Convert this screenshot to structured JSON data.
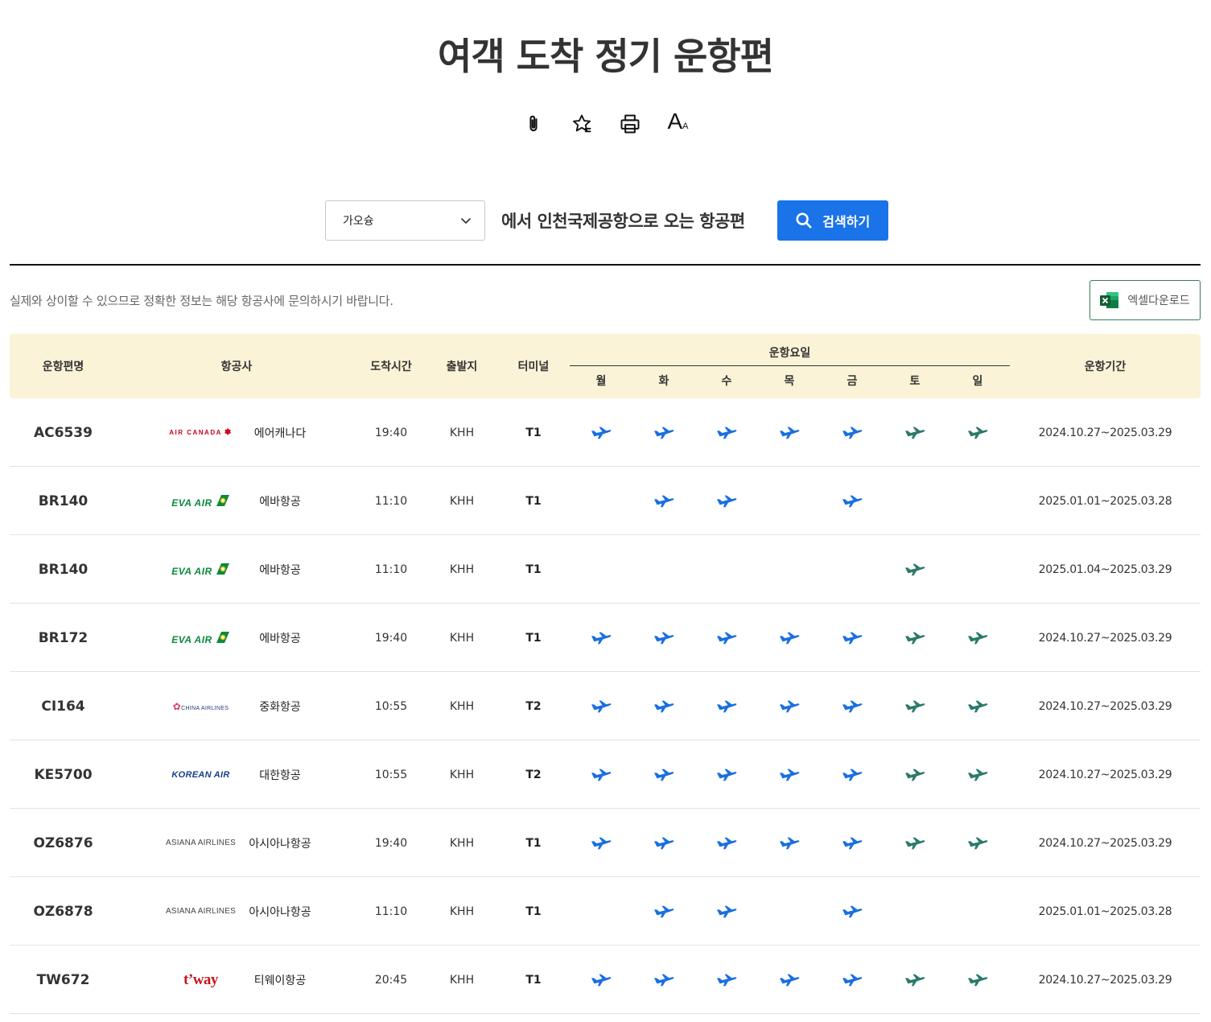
{
  "page": {
    "title": "여객 도착 정기 운항편"
  },
  "tools": [
    {
      "icon": "paperclip-icon"
    },
    {
      "icon": "star-icon"
    },
    {
      "icon": "printer-icon"
    },
    {
      "icon": "font-size-icon",
      "label": "A",
      "small": "A"
    }
  ],
  "search": {
    "select_value": "가오슝",
    "caption": "에서 인천국제공항으로 오는 항공편",
    "button_label": "검색하기"
  },
  "notice": "실제와 상이할 수 있으므로 정확한 정보는 해당 항공사에 문의하시기 바랍니다.",
  "excel_button": "엑셀다운로드",
  "colors": {
    "accent": "#1a73e8",
    "weekday_plane": "#1a6fe0",
    "weekend_plane": "#2b7a6a",
    "header_bg": "#fbf3d7"
  },
  "table": {
    "headers": {
      "flight": "운항편명",
      "airline": "항공사",
      "arrival": "도착시간",
      "origin": "출발지",
      "terminal": "터미널",
      "days_title": "운항요일",
      "period": "운항기간"
    },
    "days": [
      "월",
      "화",
      "수",
      "목",
      "금",
      "토",
      "일"
    ],
    "rows": [
      {
        "flight": "AC6539",
        "logo": "AIR CANADA",
        "airline": "에어캐나다",
        "time": "19:40",
        "origin": "KHH",
        "terminal": "T1",
        "days": [
          1,
          1,
          1,
          1,
          1,
          1,
          1
        ],
        "period": "2024.10.27~2025.03.29"
      },
      {
        "flight": "BR140",
        "logo": "EVA AIR",
        "airline": "에바항공",
        "time": "11:10",
        "origin": "KHH",
        "terminal": "T1",
        "days": [
          0,
          1,
          1,
          0,
          1,
          0,
          0
        ],
        "period": "2025.01.01~2025.03.28"
      },
      {
        "flight": "BR140",
        "logo": "EVA AIR",
        "airline": "에바항공",
        "time": "11:10",
        "origin": "KHH",
        "terminal": "T1",
        "days": [
          0,
          0,
          0,
          0,
          0,
          1,
          0
        ],
        "period": "2025.01.04~2025.03.29"
      },
      {
        "flight": "BR172",
        "logo": "EVA AIR",
        "airline": "에바항공",
        "time": "19:40",
        "origin": "KHH",
        "terminal": "T1",
        "days": [
          1,
          1,
          1,
          1,
          1,
          1,
          1
        ],
        "period": "2024.10.27~2025.03.29"
      },
      {
        "flight": "CI164",
        "logo": "CHINA AIRLINES",
        "airline": "중화항공",
        "time": "10:55",
        "origin": "KHH",
        "terminal": "T2",
        "days": [
          1,
          1,
          1,
          1,
          1,
          1,
          1
        ],
        "period": "2024.10.27~2025.03.29"
      },
      {
        "flight": "KE5700",
        "logo": "KOREAN AIR",
        "airline": "대한항공",
        "time": "10:55",
        "origin": "KHH",
        "terminal": "T2",
        "days": [
          1,
          1,
          1,
          1,
          1,
          1,
          1
        ],
        "period": "2024.10.27~2025.03.29"
      },
      {
        "flight": "OZ6876",
        "logo": "ASIANA AIRLINES",
        "airline": "아시아나항공",
        "time": "19:40",
        "origin": "KHH",
        "terminal": "T1",
        "days": [
          1,
          1,
          1,
          1,
          1,
          1,
          1
        ],
        "period": "2024.10.27~2025.03.29"
      },
      {
        "flight": "OZ6878",
        "logo": "ASIANA AIRLINES",
        "airline": "아시아나항공",
        "time": "11:10",
        "origin": "KHH",
        "terminal": "T1",
        "days": [
          0,
          1,
          1,
          0,
          1,
          0,
          0
        ],
        "period": "2025.01.01~2025.03.28"
      },
      {
        "flight": "TW672",
        "logo": "t'way",
        "airline": "티웨이항공",
        "time": "20:45",
        "origin": "KHH",
        "terminal": "T1",
        "days": [
          1,
          1,
          1,
          1,
          1,
          1,
          1
        ],
        "period": "2024.10.27~2025.03.29"
      }
    ]
  }
}
